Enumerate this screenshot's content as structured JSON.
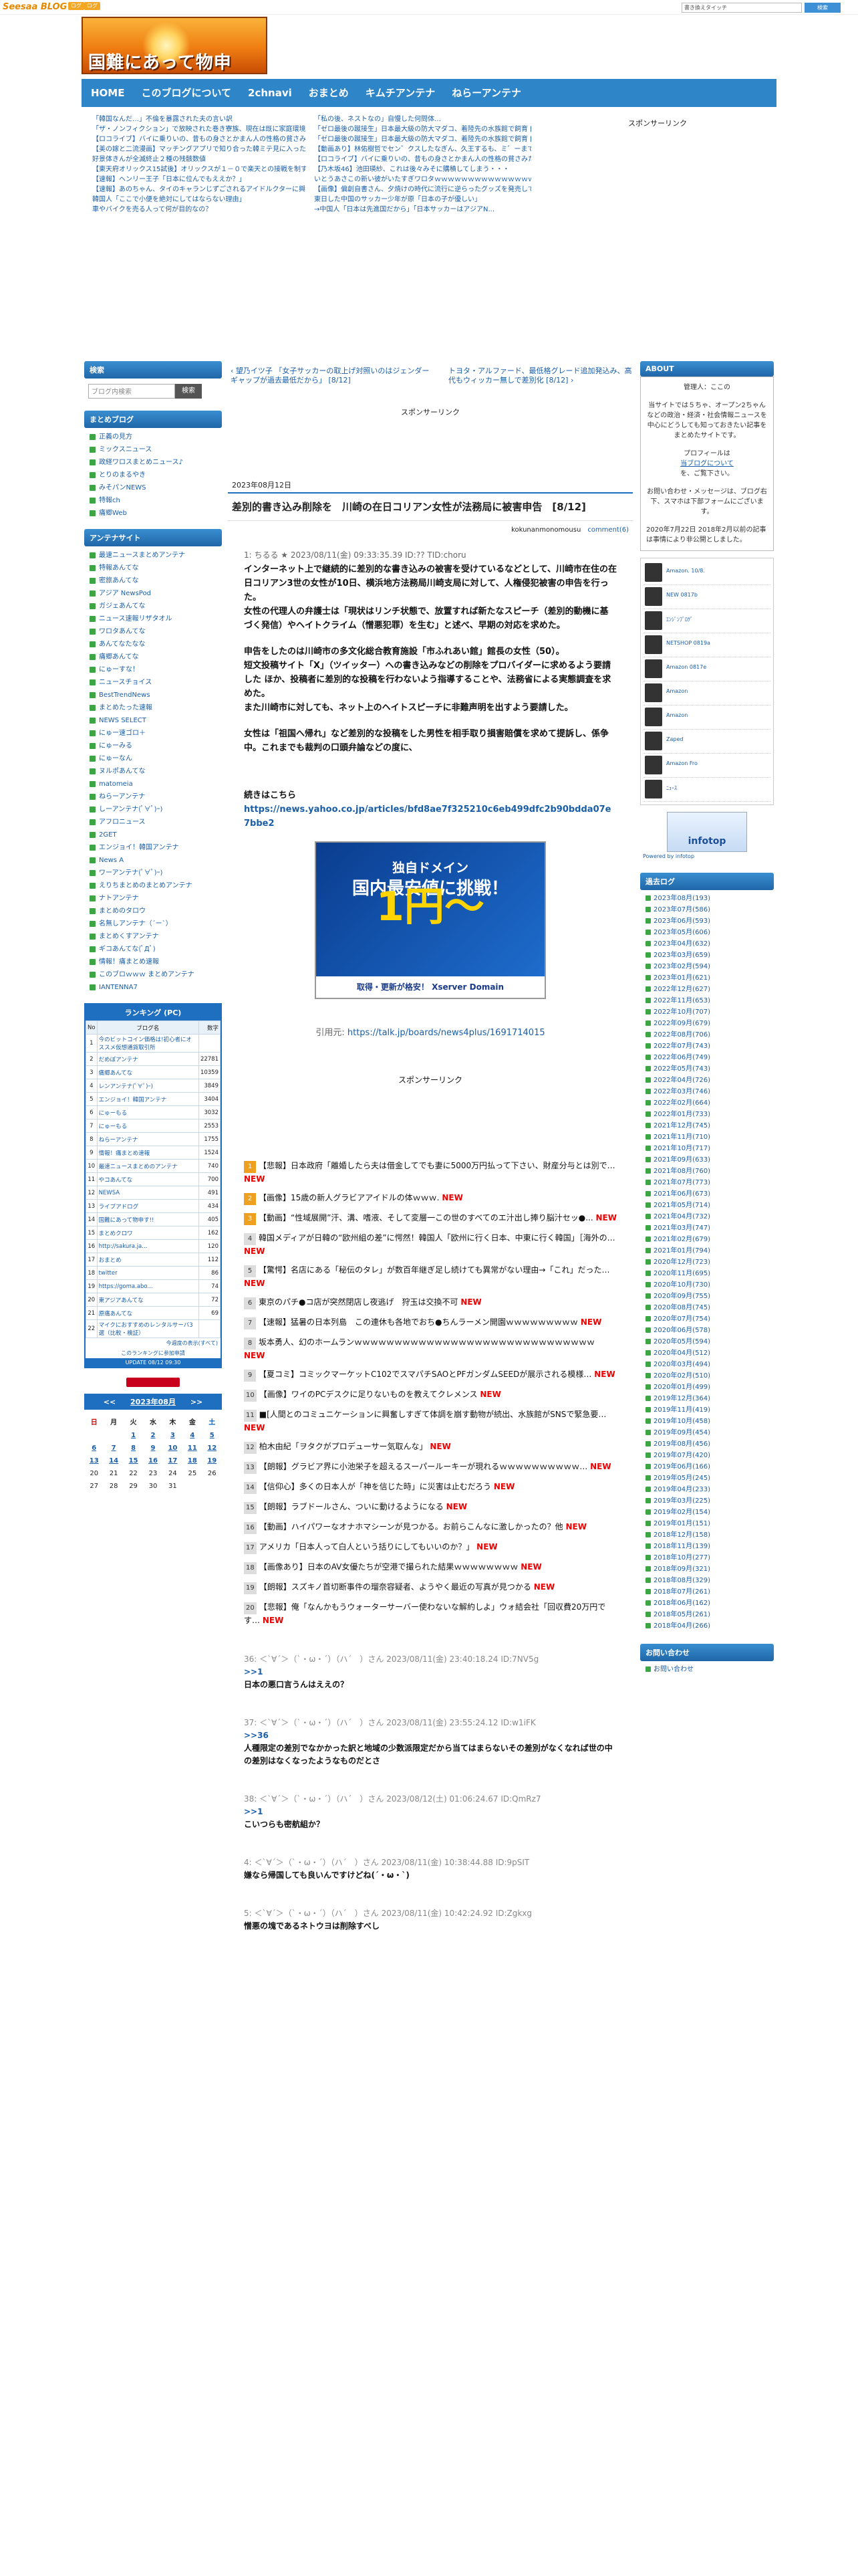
{
  "topbar": {
    "logo": "Seesaa",
    "logo_suffix": "BLOG",
    "btn1": "ログ",
    "btn2": "ログ",
    "search_placeholder": "書き換えタイッチ",
    "search_button": "検索"
  },
  "banner": {
    "title": "国難にあって物申す!!"
  },
  "nav": [
    "HOME",
    "このブログについて",
    "2chnavi",
    "おまとめ",
    "キムチアンテナ",
    "ねらーアンテナ"
  ],
  "headlines_left": [
    "「韓国なんだ…」不倫を暴露された夫の言い訳",
    "「ザ・ノンフィクション」で放映された巻き寮族、現在は既に家庭環境が崩壊していると関係者が明かす",
    "【ロコライブ】バイに乗りいの、昔もの身さとかまん人の性格の貧さみたいなもの仕業らわる",
    "【美の嫁と二流漫画】マッチングアプリで知り合った韓ミテ見に入ったらだけど、制限外かと思ったらなんと男の娘だった！ｗｗｗ",
    "好景体きんが全滅終止２種の残骸数値",
    "【東天府オリックス15試後】オリックスが１－０で楽天との接戦を制す！5投手の「正券」リレーで最少リードを守りきる！楽天は向井少年回本１失点の応...",
    "【速報】ヘンリー王子「日本に位んでもええか？」",
    "【速報】あのちゃん、タイのキャランじずごされるアイドルクターに興奮ｗｗｗ",
    "韓国人「ここで小便を絶対にしてはならない理由」",
    "車やバイクを売る人って何が目的なの？"
  ],
  "headlines_right": [
    "「私の後、ネストなの」自慢した何問体…",
    "「ゼロ最後の蹴接生」日本最大級の防大マダコ、着陸先の水族館で飼育 [8/13]",
    "「ゼロ最後の蹴接生」日本最大級の防大マダコ、着陸先の水族館で飼育 [8/13]",
    "【動画あり】林佑樹哲でセン゛クスしたなぎん、久王するも、ミ゛ーまで許された続ある…",
    "【ロコライブ】バイに乗りいの、昔もの身さとかまん人の性格の貧さみたいなもの仕業らわる",
    "【乃木坂46】池田瑛紗、これは後々みそに購積してしまう・・・",
    "いとうあさこの新い彼がいたすぎワロタｗｗｗｗｗｗｗｗｗｗｗｗｗｗｗｗｗｗｗｗｗｗｗ",
    "【画像】偏創自書さん、夕焼けの時代に流行に逆らったグッズを発売してしまうｗｗｗ",
    "東日した中国のサッカー少年が原「日本の子が優しい」",
    "→中国人「日本は先進国だから」「日本サッカーはアジアN..."
  ],
  "sponsor_label": "スポンサーリンク",
  "left": {
    "search_title": "検索",
    "search_placeholder": "ブログ内検索",
    "search_button": "検索",
    "matome_title": "まとめブログ",
    "matome": [
      "正義の見方",
      "ミックスニュース",
      "政経ワロスまとめニュース♪",
      "とりのまるやき",
      "みそパンNEWS",
      "特報ch",
      "痛郷Web"
    ],
    "antenna_title": "アンテナサイト",
    "antenna": [
      "最速ニュースまとめアンテナ",
      "特報あんてな",
      "密旅あんてな",
      "アジア NewsPod",
      "ガジェあんてな",
      "ニュース速報リザタオル",
      "ワロタあんてな",
      "あんてなたなな",
      "痛郷あんてな",
      "にゅーすな！",
      "ニュースチョイス",
      "BestTrendNews",
      "まとめたった速報",
      "NEWS SELECT",
      "にゅー速ゴロ＋",
      "にゅーみる",
      "にゅーなん",
      "ヌルポあんてな",
      "matomeia",
      "ねらーアンテナ",
      "しーアンテナ(ﾟ∀ﾟ)ｰ)",
      "アフロニュース",
      "2GET",
      "エンジョイ！韓国アンテナ",
      "News A",
      "ワーアンテナ(ﾟ∀ﾟ)ｰ)",
      "えりちまとめのまとめアンテナ",
      "ナトアンテナ",
      "まとめのタロウ",
      "名無しアンテナ（´ー`）",
      "まとめくすアンテナ",
      "ギコあんてな(ﾟДﾟ)",
      "情報！痛まとめ速報",
      "このブロｗｗｗ まとめアンテナ",
      "IANTENNA7"
    ],
    "rank_title": "ランキング (PC)",
    "rank_headers": [
      "No",
      "ブログ名",
      "数字"
    ],
    "rank": [
      [
        "1",
        "今のビットコイン価格は!初心者にオススメ仮想通貨取引所",
        "",
        "4"
      ],
      [
        "2",
        "だめぽアンテナ",
        "22781",
        ""
      ],
      [
        "3",
        "痛郷あんてな",
        "10359",
        ""
      ],
      [
        "4",
        "レンアンテナ(ﾟ∀ﾟ)ｰ)",
        "3849",
        ""
      ],
      [
        "5",
        "エンジョイ！韓国アンテナ",
        "3404",
        ""
      ],
      [
        "6",
        "にゅーもる",
        "3032",
        ""
      ],
      [
        "7",
        "にゅーもる",
        "2553",
        ""
      ],
      [
        "8",
        "ねらーアンテナ",
        "1755",
        ""
      ],
      [
        "9",
        "情報！痛まとめ速報",
        "1524",
        ""
      ],
      [
        "10",
        "最速ニュースまとめのアンテナ",
        "740",
        ""
      ],
      [
        "11",
        "やコあんてな",
        "700",
        ""
      ],
      [
        "12",
        "NEWSA",
        "491",
        ""
      ],
      [
        "13",
        "ライブアドログ",
        "434",
        ""
      ],
      [
        "14",
        "国難にあって物申す!!",
        "405",
        ""
      ],
      [
        "15",
        "まとめクロワ",
        "162",
        ""
      ],
      [
        "16",
        "http://sakura.ja...",
        "120",
        ""
      ],
      [
        "17",
        "おまとめ",
        "112",
        ""
      ],
      [
        "18",
        "twitter",
        "86",
        ""
      ],
      [
        "19",
        "https://goma.abo...",
        "74",
        ""
      ],
      [
        "20",
        "東アジアあんてな",
        "72",
        ""
      ],
      [
        "21",
        "原痛あんてな",
        "69",
        ""
      ],
      [
        "22",
        "マイクにおすすめのレンタルサーバ3選（比較・検証）",
        "",
        ""
      ]
    ],
    "rank_more": "今週度の表示(すべて)",
    "rank_footer": "このランキングに参加申請",
    "rank_update": "UPDATE 08/12 09:30",
    "cal_title": "2023年08月",
    "cal_prev": "<<",
    "cal_next": ">>",
    "cal_days": [
      "日",
      "月",
      "火",
      "水",
      "木",
      "金",
      "土"
    ],
    "cal_rows": [
      [
        "",
        "",
        "1",
        "2",
        "3",
        "4",
        "5"
      ],
      [
        "6",
        "7",
        "8",
        "9",
        "10",
        "11",
        "12"
      ],
      [
        "13",
        "14",
        "15",
        "16",
        "17",
        "18",
        "19"
      ],
      [
        "20",
        "21",
        "22",
        "23",
        "24",
        "25",
        "26"
      ],
      [
        "27",
        "28",
        "29",
        "30",
        "31",
        "",
        ""
      ]
    ]
  },
  "post": {
    "prev_link": "望乃イツ子 「女子サッカーの取上げ対照いのはジェンダーギャップが過去最低だから」 [8/12]",
    "next_link": "トヨタ・アルファード、最低格グレード追加発込み、高代もウィッカー無しで差別化 [8/12]",
    "sponsor": "スポンサーリンク",
    "date": "2023年08月12日",
    "title": "差別的書き込み削除を　川崎の在日コリアン女性が法務局に被害申告　[8/12]",
    "author": "kokunanmonomousu",
    "comments": "comment(6)",
    "header_line": "1: ちるる ★ 2023/08/11(金) 09:33:35.39 ID:?? TID:choru",
    "p1": "インターネット上で継続的に差別的な書き込みの被害を受けているなどとして、川崎市在住の在日コリアン3世の女性が10日、横浜地方法務局川崎支局に対して、人権侵犯被害の申告を行った。",
    "p2": "女性の代理人の弁護士は「現状はリンチ状態で、放置すれば新たなスピーチ（差別的動機に基づく発信）やヘイトクライム（憎悪犯罪）を生む」と述べ、早期の対応を求めた。",
    "p3": "申告をしたのは川崎市の多文化総合教育施設「市ふれあい館」館長の女性（50）。",
    "p4": "短文投稿サイト「X」（ツイッター）への書き込みなどの削除をプロバイダーに求めるよう要請した ほか、投稿者に差別的な投稿を行わないよう指導することや、法務省による実態調査を求めた。",
    "p5": "また川崎市に対しても、ネット上のヘイトスピーチに非難声明を出すよう要請した。",
    "p6": "女性は「祖国へ帰れ」など差別的な投稿をした男性を相手取り損害賠償を求めて提訴し、係争中。これまでも裁判の口頭弁論などの度に、",
    "cont": "続きはこちら",
    "url": "https://news.yahoo.co.jp/articles/bfd8ae7f325210c6eb499dfc2b90bdda07e7bbe2",
    "ad_t1": "独自ドメイン",
    "ad_t2": "国内最安値に挑戦！",
    "ad_t3": "1円〜",
    "ad_t4": "取得・更新が格安！ Xserver Domain",
    "quote_label": "引用元: ",
    "quote_url": "https://talk.jp/boards/news4plus/1691714015",
    "sponsor2": "スポンサーリンク"
  },
  "related": [
    [
      "1",
      "【悲報】日本政府「離婚したら夫は借金してでも妻に5000万円払って下さい、財産分与とは別で…",
      "NEW"
    ],
    [
      "2",
      "【画像】15歳の新人グラビアアイドルの体ｗｗｗ.",
      "NEW"
    ],
    [
      "3",
      "【動画】“性域展開”汗、溝、嗜液、そして変層一この世のすべてのエ汁出し捧り脳汁セッ●...",
      "NEW"
    ],
    [
      "4",
      "韓国メディアが日韓の“欧州組の差”に愕然！韓国人「欧州に行く日本、中東に行く韓国」［海外の…",
      "NEW"
    ],
    [
      "5",
      "【驚愕】名店にある「秘伝のタレ」が数百年継ぎ足し続けても異常がない理由→「これ」だった…",
      "NEW"
    ],
    [
      "6",
      "東京のパチ●コ店が突然閉店し夜逃げ　狩玉は交換不可",
      "NEW"
    ],
    [
      "7",
      "【速報】猛暑の日本列島　この連休も各地でおち●ちんラーメン開園ｗｗｗｗｗｗｗｗｗ",
      "NEW"
    ],
    [
      "8",
      "坂本勇人、幻のホームランｗｗｗｗｗｗｗｗｗｗｗｗｗｗｗｗｗｗｗｗｗｗｗｗｗｗｗｗｗｗ",
      "NEW"
    ],
    [
      "9",
      "【夏コミ】コミックマーケットC102でスマパチSAOとPFガンダムSEEDが展示される模様…",
      "NEW"
    ],
    [
      "10",
      "【画像】ワイのPCデスクに足りないものを教えてクレメンス",
      "NEW"
    ],
    [
      "11",
      "■[人間とのコミュニケーションに興奮しすぎて体調を崩す動物が続出、水族館がSNSで緊急要…",
      "NEW"
    ],
    [
      "12",
      "柏木由紀「ヲタクがプロデューサー気取んな」",
      "NEW"
    ],
    [
      "13",
      "【朗報】グラビア界に小池栄子を超えるスーパールーキーが現れるｗｗｗｗｗｗｗｗｗｗ…",
      "NEW"
    ],
    [
      "14",
      "【信仰心】多くの日本人が「神を信じた時」に災害は止むだろう",
      "NEW"
    ],
    [
      "15",
      "【朗報】ラブドールさん、ついに動けるようになる",
      "NEW"
    ],
    [
      "16",
      "【動画】ハイパワーなオナホマシーンが見つかる。お前らこんなに激しかったの？他",
      "NEW"
    ],
    [
      "17",
      "アメリカ「日本人って白人という括りにしてもいいのか？」",
      "NEW"
    ],
    [
      "18",
      "【画像あり】日本のAV女優たちが空港で撮られた結果ｗｗｗｗｗｗｗｗ",
      "NEW"
    ],
    [
      "19",
      "【朗報】スズキノ首切断事件の瑠奈容疑者、ようやく最近の写真が見つかる",
      "NEW"
    ],
    [
      "20",
      "【悲報】俺「なんかもうウォーターサーバー使わないな解約しよ」ウォ結会社「回収費20万円です…",
      "NEW"
    ]
  ],
  "comments": [
    {
      "h": "36: ＜`∀´＞（`・ω・´）（ハ´　）さん 2023/08/11(金) 23:40:18.24 ID:7NV5g",
      "a": ">>1",
      "b": "日本の悪口言うんはええの？"
    },
    {
      "h": "37: ＜`∀´＞（`・ω・´）（ハ´　）さん 2023/08/11(金) 23:55:24.12 ID:w1iFK",
      "a": ">>36",
      "b": "人種限定の差別でなかかった訳と地域の少数派限定だから当てはまらないその差別がなくなれば世の中の差別はなくなったようなものだとさ"
    },
    {
      "h": "38: ＜`∀´＞（`・ω・´）（ハ´　）さん 2023/08/12(土) 01:06:24.67 ID:QmRz7",
      "a": ">>1",
      "b": "こいつらも密航組か？"
    },
    {
      "h": "4: ＜`∀´＞（`・ω・´）（ハ´　）さん 2023/08/11(金) 10:38:44.88 ID:9pSIT",
      "a": "",
      "b": "嫌なら帰国しても良いんですけどね(´・ω・`)"
    },
    {
      "h": "5: ＜`∀´＞（`・ω・´）（ハ´　）さん 2023/08/11(金) 10:42:24.92 ID:Zgkxg",
      "a": "",
      "b": "憎悪の塊であるネトウヨは削除すべし"
    }
  ],
  "right": {
    "about_title": "ABOUT",
    "about_lines": [
      "管理人：ここの",
      "当サイトでは５ちゃ、オープン2ちゃんなどの政治・経済・社会情報ニュースを中心にどうしても知っておきたい記事をまとめたサイトです。",
      "プロフィールは",
      "当ブログについて",
      "を、ご覧下さい。",
      "お問い合わせ・メッセージは、ブログ右下、スマホは下部フォームにございます。",
      "2020年7月22日 2018年2月以前の記事は事情により非公開としました。"
    ],
    "blogroll": [
      "Amazon. 10/8.",
      "NEW 0817b",
      "ｴﾝｼﾞﾝﾌﾞﾛｸﾞ",
      "NETSHOP 0819a",
      "Amazon 0817e",
      "Amazon",
      "Amazon",
      "Zaped",
      "Amazon Fro",
      "ﾆｭｰｽ"
    ],
    "infotop": "infotop",
    "powered": "Powered by infotop",
    "archive_title": "過去ログ",
    "archive": [
      "2023年08月(193)",
      "2023年07月(586)",
      "2023年06月(593)",
      "2023年05月(606)",
      "2023年04月(632)",
      "2023年03月(659)",
      "2023年02月(594)",
      "2023年01月(621)",
      "2022年12月(627)",
      "2022年11月(653)",
      "2022年10月(707)",
      "2022年09月(679)",
      "2022年08月(706)",
      "2022年07月(743)",
      "2022年06月(749)",
      "2022年05月(743)",
      "2022年04月(726)",
      "2022年03月(746)",
      "2022年02月(664)",
      "2022年01月(733)",
      "2021年12月(745)",
      "2021年11月(710)",
      "2021年10月(717)",
      "2021年09月(633)",
      "2021年08月(760)",
      "2021年07月(773)",
      "2021年06月(673)",
      "2021年05月(714)",
      "2021年04月(732)",
      "2021年03月(747)",
      "2021年02月(679)",
      "2021年01月(794)",
      "2020年12月(723)",
      "2020年11月(695)",
      "2020年10月(730)",
      "2020年09月(755)",
      "2020年08月(745)",
      "2020年07月(754)",
      "2020年06月(578)",
      "2020年05月(594)",
      "2020年04月(512)",
      "2020年03月(494)",
      "2020年02月(510)",
      "2020年01月(499)",
      "2019年12月(364)",
      "2019年11月(419)",
      "2019年10月(458)",
      "2019年09月(454)",
      "2019年08月(456)",
      "2019年07月(420)",
      "2019年06月(166)",
      "2019年05月(245)",
      "2019年04月(233)",
      "2019年03月(225)",
      "2019年02月(154)",
      "2019年01月(151)",
      "2018年12月(158)",
      "2018年11月(139)",
      "2018年10月(277)",
      "2018年09月(321)",
      "2018年08月(329)",
      "2018年07月(261)",
      "2018年06月(162)",
      "2018年05月(261)",
      "2018年04月(266)"
    ],
    "contact_title": "お問い合わせ",
    "contact_link": "お問い合わせ"
  }
}
